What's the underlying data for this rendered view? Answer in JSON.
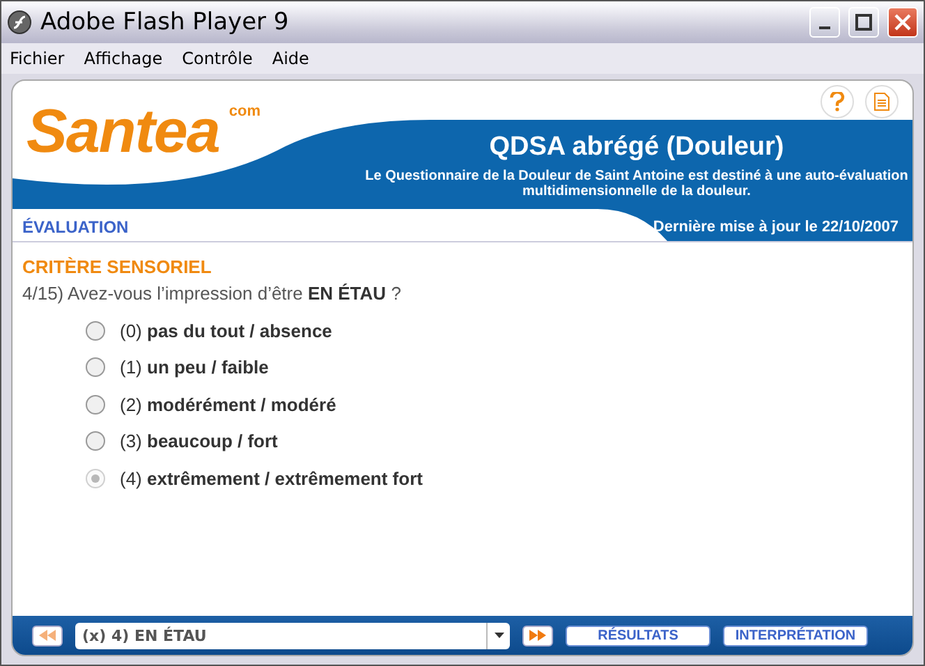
{
  "window": {
    "title": "Adobe Flash Player 9"
  },
  "menu": [
    "Fichier",
    "Affichage",
    "Contrôle",
    "Aide"
  ],
  "header": {
    "logo": "Santea",
    "logo_suffix": "com",
    "title": "QDSA abrégé (Douleur)",
    "subtitle": "Le Questionnaire de la Douleur de Saint Antoine est destiné à une auto-évaluation multidimensionnelle de la douleur.",
    "section": "ÉVALUATION",
    "updated": "Dernière mise à jour le 22/10/2007"
  },
  "category": "CRITÈRE SENSORIEL",
  "question": "4/15) Avez-vous l’impression d’être **EN ÉTAU** ?",
  "options": [
    {
      "label": "(0) **pas du tout / absence**",
      "selected": false
    },
    {
      "label": "(1) **un peu / faible**",
      "selected": false
    },
    {
      "label": "(2) **modérément / modéré**",
      "selected": false
    },
    {
      "label": "(3) **beaucoup / fort**",
      "selected": false
    },
    {
      "label": "(4) **extrêmement / extrêmement fort**",
      "selected": true
    }
  ],
  "footer": {
    "dropdown": "(x) 4) EN ÉTAU",
    "buttons": [
      "RÉSULTATS",
      "INTERPRÉTATION"
    ]
  }
}
